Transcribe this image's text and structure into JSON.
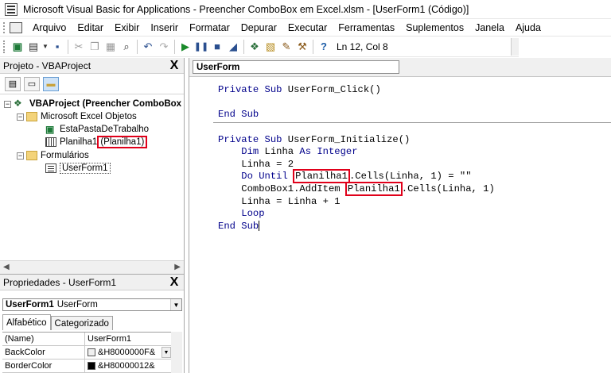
{
  "window": {
    "title": "Microsoft Visual Basic for Applications - Preencher ComboBox em Excel.xlsm - [UserForm1 (Código)]"
  },
  "menu": [
    {
      "label": "Arquivo"
    },
    {
      "label": "Editar"
    },
    {
      "label": "Exibir"
    },
    {
      "label": "Inserir"
    },
    {
      "label": "Formatar"
    },
    {
      "label": "Depurar"
    },
    {
      "label": "Executar"
    },
    {
      "label": "Ferramentas"
    },
    {
      "label": "Suplementos"
    },
    {
      "label": "Janela"
    },
    {
      "label": "Ajuda"
    }
  ],
  "toolbar": {
    "status": "Ln 12, Col 8",
    "icons": [
      "view-excel-icon",
      "insert-userform-icon",
      "save-icon",
      "cut-icon",
      "copy-icon",
      "paste-icon",
      "find-icon",
      "undo-icon",
      "redo-icon",
      "run-icon",
      "break-icon",
      "reset-icon",
      "design-mode-icon",
      "project-explorer-icon",
      "properties-icon",
      "object-browser-icon",
      "toolbox-icon",
      "help-icon"
    ]
  },
  "project_panel": {
    "title": "Projeto - VBAProject",
    "close": "X",
    "tree": {
      "root": "VBAProject (Preencher ComboBox",
      "excel_objects_folder": "Microsoft Excel Objetos",
      "workbook": "EstaPastaDeTrabalho",
      "sheet_name": "Planilha1",
      "sheet_caption": "(Planilha1)",
      "forms_folder": "Formulários",
      "userform": "UserForm1"
    }
  },
  "properties_panel": {
    "title": "Propriedades - UserForm1",
    "close": "X",
    "object_name": "UserForm1",
    "object_type": "UserForm",
    "tabs": [
      "Alfabético",
      "Categorizado"
    ],
    "rows": [
      {
        "name": "(Name)",
        "value": "UserForm1"
      },
      {
        "name": "BackColor",
        "value": "&H8000000F&",
        "swatch": "#f0f0f0"
      },
      {
        "name": "BorderColor",
        "value": "&H80000012&",
        "swatch": "#000000"
      }
    ]
  },
  "code_window": {
    "object_selector": "UserForm",
    "lines": {
      "l1_kw": "Private Sub",
      "l1_rest": " UserForm_Click()",
      "l2_kw": "End Sub",
      "l3_kw": "Private Sub",
      "l3_rest": " UserForm_Initialize()",
      "l4_kw": "Dim",
      "l4_mid": " Linha ",
      "l4_kw2": "As Integer",
      "l5": "Linha = 2",
      "l6_kw": "Do Until",
      "l6_hl": "Planilha1",
      "l6_rest": ".Cells(Linha, 1) = \"\"",
      "l7_pre": "ComboBox1.AddItem ",
      "l7_hl": "Planilha1",
      "l7_rest": ".Cells(Linha, 1)",
      "l8": "Linha = Linha + 1",
      "l9_kw": "Loop",
      "l10_kw": "End Sub"
    }
  },
  "colors": {
    "keyword": "#00008b",
    "highlight_border": "#e0001a"
  }
}
